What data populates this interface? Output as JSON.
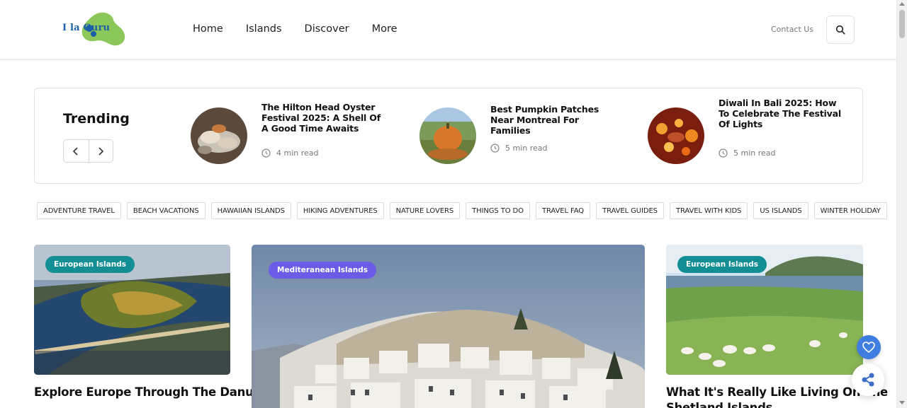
{
  "header": {
    "logo_text": "I  la Guru",
    "nav": [
      "Home",
      "Islands",
      "Discover",
      "More"
    ],
    "contact_label": "Contact Us",
    "search_icon": "search-icon"
  },
  "trending": {
    "title": "Trending",
    "prev_icon": "chevron-left-icon",
    "next_icon": "chevron-right-icon",
    "items": [
      {
        "title": "The Hilton Head Oyster Festival 2025: A Shell Of A Good Time Awaits",
        "read_time": "4 min read"
      },
      {
        "title": "Best Pumpkin Patches Near Montreal For Families",
        "read_time": "5 min read"
      },
      {
        "title": "Diwali In Bali 2025: How To Celebrate The Festival Of Lights",
        "read_time": "5 min read"
      }
    ]
  },
  "tags": [
    "ADVENTURE TRAVEL",
    "BEACH VACATIONS",
    "HAWAIIAN ISLANDS",
    "HIKING ADVENTURES",
    "NATURE LOVERS",
    "THINGS TO DO",
    "TRAVEL FAQ",
    "TRAVEL GUIDES",
    "TRAVEL WITH KIDS",
    "US ISLANDS",
    "WINTER HOLIDAY"
  ],
  "cards": [
    {
      "badge": "European Islands",
      "title": "Explore Europe Through The Danube"
    },
    {
      "badge": "Mediteranean Islands",
      "title": ""
    },
    {
      "badge": "European Islands",
      "title": "What It's Really Like Living On The",
      "title_line2": "Shetland Islands"
    }
  ],
  "colors": {
    "badge_teal": "#138e95",
    "badge_purple": "#6b5ce7",
    "fab_blue": "#3f7de0",
    "logo_green": "#8cc75a"
  }
}
